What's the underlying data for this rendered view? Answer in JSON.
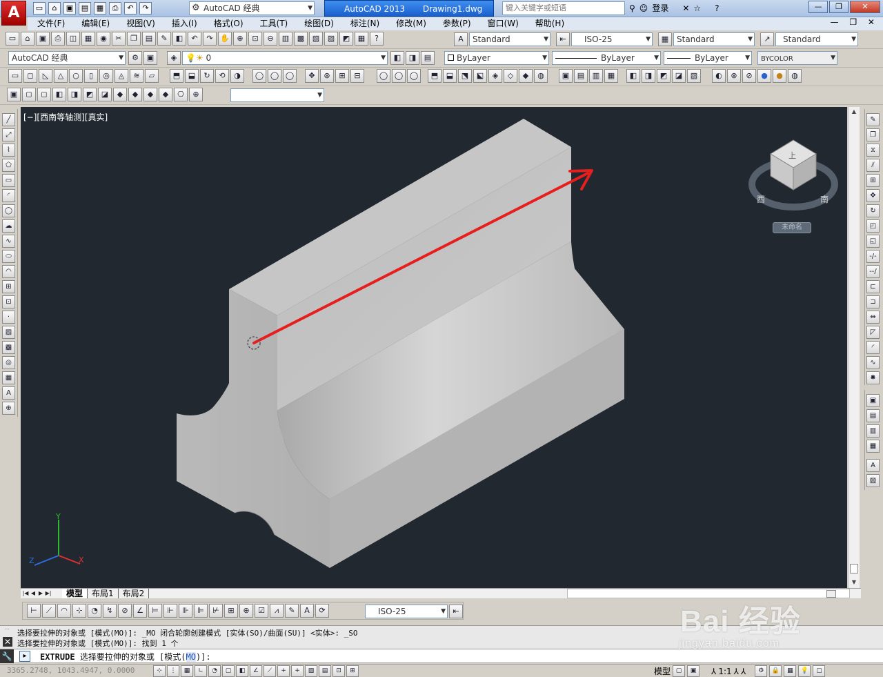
{
  "app": {
    "logo_letter": "A",
    "workspace": "AutoCAD 经典",
    "title_app": "AutoCAD 2013",
    "title_doc": "Drawing1.dwg",
    "search_placeholder": "键入关键字或短语",
    "login": "登录"
  },
  "menu": [
    "文件(F)",
    "编辑(E)",
    "视图(V)",
    "插入(I)",
    "格式(O)",
    "工具(T)",
    "绘图(D)",
    "标注(N)",
    "修改(M)",
    "参数(P)",
    "窗口(W)",
    "帮助(H)"
  ],
  "styles": {
    "text_style": "Standard",
    "dim_style": "ISO-25",
    "table_style": "Standard",
    "multileader_style": "Standard"
  },
  "layers": {
    "workspace": "AutoCAD 经典",
    "current_layer": "0",
    "color": "ByLayer",
    "linetype": "ByLayer",
    "lineweight": "ByLayer",
    "plot_style": "BYCOLOR"
  },
  "viewport": {
    "label": "[−][西南等轴测][真实]",
    "viewcube_top": "上",
    "viewcube_south": "南",
    "viewcube_west": "西",
    "viewcube_name": "未命名"
  },
  "tabs": [
    "模型",
    "布局1",
    "布局2"
  ],
  "dim_toolbar": {
    "dim_style": "ISO-25"
  },
  "command": {
    "history1": "选择要拉伸的对象或 [模式(MO)]: _MO 闭合轮廓创建模式 [实体(SO)/曲面(SU)] <实体>: _SO",
    "history2": "选择要拉伸的对象或 [模式(MO)]: 找到 1 个",
    "prompt_kw": "EXTRUDE",
    "prompt_text": "选择要拉伸的对象或 [模式(",
    "prompt_opt": "MO",
    "prompt_end": ")]:"
  },
  "status": {
    "coords": "3365.2748, 1043.4947, 0.0000",
    "model_label": "模型",
    "scale": "1:1"
  },
  "watermark": {
    "brand": "Bai  经验",
    "url": "jingyan.baidu.com"
  },
  "colors": {
    "viewport_bg": "#212830",
    "arrow": "#e61e1e",
    "solid_light": "#c4c4c4",
    "solid_mid": "#b6b6b6",
    "solid_dark": "#a8a8a8"
  }
}
